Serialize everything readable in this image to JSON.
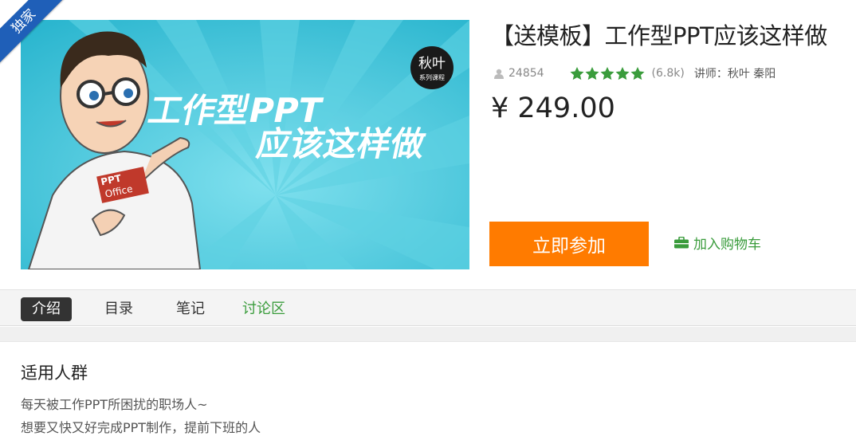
{
  "badge": {
    "label": "独家"
  },
  "banner": {
    "brand": "秋叶",
    "brand_sub": "系列课程",
    "headline_1": "工作型PPT",
    "headline_2": "应该这样做",
    "shirt_1": "PPT",
    "shirt_2": "Office"
  },
  "course": {
    "title": "【送模板】工作型PPT应该这样做",
    "students": "24854",
    "rating_stars": 5,
    "rating_count": "(6.8k)",
    "teacher": "讲师：秋叶 秦阳",
    "price": "¥ 249.00"
  },
  "actions": {
    "join_label": "立即参加",
    "cart_label": "加入购物车"
  },
  "tabs": [
    {
      "label": "介绍"
    },
    {
      "label": "目录"
    },
    {
      "label": "笔记"
    },
    {
      "label": "讨论区"
    }
  ],
  "intro": {
    "section_title": "适用人群",
    "lines": [
      "每天被工作PPT所困扰的职场人~",
      "想要又快又好完成PPT制作，提前下班的人"
    ]
  },
  "colors": {
    "accent_orange": "#ff7b00",
    "green": "#3a9c3c",
    "badge_blue": "#1f5fb8",
    "banner_cyan": "#3cc3d8"
  }
}
